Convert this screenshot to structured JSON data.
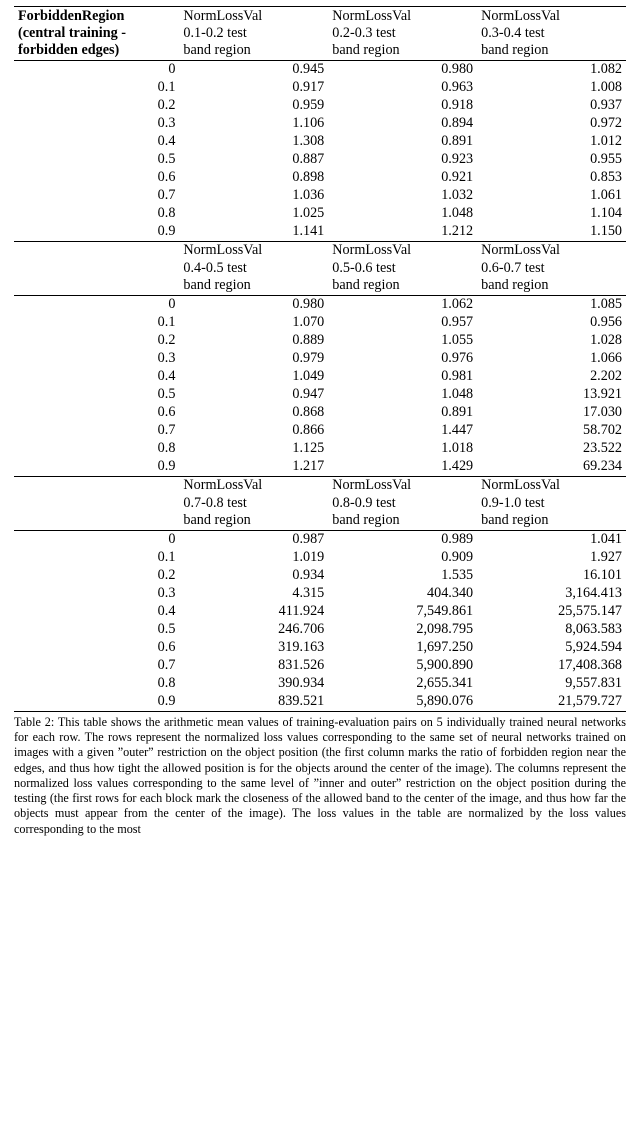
{
  "table": {
    "header0": {
      "col0_l1": "ForbiddenRegion",
      "col0_l2": "(central training -",
      "col0_l3": "forbidden edges)"
    },
    "blocks": [
      {
        "hdr": {
          "c1_l1": "NormLossVal",
          "c1_l2": "0.1-0.2 test",
          "c1_l3": "band region",
          "c2_l1": "NormLossVal",
          "c2_l2": "0.2-0.3 test",
          "c2_l3": "band region",
          "c3_l1": "NormLossVal",
          "c3_l2": "0.3-0.4 test",
          "c3_l3": "band region"
        },
        "rows": [
          {
            "k": "0",
            "v": [
              "0.945",
              "0.980",
              "1.082"
            ]
          },
          {
            "k": "0.1",
            "v": [
              "0.917",
              "0.963",
              "1.008"
            ]
          },
          {
            "k": "0.2",
            "v": [
              "0.959",
              "0.918",
              "0.937"
            ]
          },
          {
            "k": "0.3",
            "v": [
              "1.106",
              "0.894",
              "0.972"
            ]
          },
          {
            "k": "0.4",
            "v": [
              "1.308",
              "0.891",
              "1.012"
            ]
          },
          {
            "k": "0.5",
            "v": [
              "0.887",
              "0.923",
              "0.955"
            ]
          },
          {
            "k": "0.6",
            "v": [
              "0.898",
              "0.921",
              "0.853"
            ]
          },
          {
            "k": "0.7",
            "v": [
              "1.036",
              "1.032",
              "1.061"
            ]
          },
          {
            "k": "0.8",
            "v": [
              "1.025",
              "1.048",
              "1.104"
            ]
          },
          {
            "k": "0.9",
            "v": [
              "1.141",
              "1.212",
              "1.150"
            ]
          }
        ]
      },
      {
        "hdr": {
          "c1_l1": "NormLossVal",
          "c1_l2": "0.4-0.5 test",
          "c1_l3": "band region",
          "c2_l1": "NormLossVal",
          "c2_l2": "0.5-0.6 test",
          "c2_l3": "band region",
          "c3_l1": "NormLossVal",
          "c3_l2": "0.6-0.7 test",
          "c3_l3": "band region"
        },
        "rows": [
          {
            "k": "0",
            "v": [
              "0.980",
              "1.062",
              "1.085"
            ]
          },
          {
            "k": "0.1",
            "v": [
              "1.070",
              "0.957",
              "0.956"
            ]
          },
          {
            "k": "0.2",
            "v": [
              "0.889",
              "1.055",
              "1.028"
            ]
          },
          {
            "k": "0.3",
            "v": [
              "0.979",
              "0.976",
              "1.066"
            ]
          },
          {
            "k": "0.4",
            "v": [
              "1.049",
              "0.981",
              "2.202"
            ]
          },
          {
            "k": "0.5",
            "v": [
              "0.947",
              "1.048",
              "13.921"
            ]
          },
          {
            "k": "0.6",
            "v": [
              "0.868",
              "0.891",
              "17.030"
            ]
          },
          {
            "k": "0.7",
            "v": [
              "0.866",
              "1.447",
              "58.702"
            ]
          },
          {
            "k": "0.8",
            "v": [
              "1.125",
              "1.018",
              "23.522"
            ]
          },
          {
            "k": "0.9",
            "v": [
              "1.217",
              "1.429",
              "69.234"
            ]
          }
        ]
      },
      {
        "hdr": {
          "c1_l1": "NormLossVal",
          "c1_l2": "0.7-0.8 test",
          "c1_l3": "band region",
          "c2_l1": "NormLossVal",
          "c2_l2": "0.8-0.9 test",
          "c2_l3": "band region",
          "c3_l1": "NormLossVal",
          "c3_l2": "0.9-1.0 test",
          "c3_l3": "band region"
        },
        "rows": [
          {
            "k": "0",
            "v": [
              "0.987",
              "0.989",
              "1.041"
            ]
          },
          {
            "k": "0.1",
            "v": [
              "1.019",
              "0.909",
              "1.927"
            ]
          },
          {
            "k": "0.2",
            "v": [
              "0.934",
              "1.535",
              "16.101"
            ]
          },
          {
            "k": "0.3",
            "v": [
              "4.315",
              "404.340",
              "3,164.413"
            ]
          },
          {
            "k": "0.4",
            "v": [
              "411.924",
              "7,549.861",
              "25,575.147"
            ]
          },
          {
            "k": "0.5",
            "v": [
              "246.706",
              "2,098.795",
              "8,063.583"
            ]
          },
          {
            "k": "0.6",
            "v": [
              "319.163",
              "1,697.250",
              "5,924.594"
            ]
          },
          {
            "k": "0.7",
            "v": [
              "831.526",
              "5,900.890",
              "17,408.368"
            ]
          },
          {
            "k": "0.8",
            "v": [
              "390.934",
              "2,655.341",
              "9,557.831"
            ]
          },
          {
            "k": "0.9",
            "v": [
              "839.521",
              "5,890.076",
              "21,579.727"
            ]
          }
        ]
      }
    ]
  },
  "caption": {
    "label": "Table 2:",
    "text": " This table shows the arithmetic mean values of training-evaluation pairs on 5 individually trained neural networks for each row. The rows represent the normalized loss values corresponding to the same set of neural networks trained on images with a given ”outer” restriction on the object position (the first column marks the ratio of forbidden region near the edges, and thus how tight the allowed position is for the objects around the center of the image). The columns represent the normalized loss values corresponding to the same level of ”inner and outer” restriction on the object position during the testing (the first rows for each block mark the closeness of the allowed band to the center of the image, and thus how far the objects must appear from the center of the image). The loss values in the table are normalized by the loss values corresponding to the most"
  },
  "chart_data": {
    "type": "table",
    "title": "Table 2",
    "row_labels_name": "ForbiddenRegion (central training - forbidden edges)",
    "row_labels": [
      0,
      0.1,
      0.2,
      0.3,
      0.4,
      0.5,
      0.6,
      0.7,
      0.8,
      0.9
    ],
    "columns": [
      "NormLossVal 0.1-0.2 test band region",
      "NormLossVal 0.2-0.3 test band region",
      "NormLossVal 0.3-0.4 test band region",
      "NormLossVal 0.4-0.5 test band region",
      "NormLossVal 0.5-0.6 test band region",
      "NormLossVal 0.6-0.7 test band region",
      "NormLossVal 0.7-0.8 test band region",
      "NormLossVal 0.8-0.9 test band region",
      "NormLossVal 0.9-1.0 test band region"
    ],
    "data": [
      [
        0.945,
        0.98,
        1.082,
        0.98,
        1.062,
        1.085,
        0.987,
        0.989,
        1.041
      ],
      [
        0.917,
        0.963,
        1.008,
        1.07,
        0.957,
        0.956,
        1.019,
        0.909,
        1.927
      ],
      [
        0.959,
        0.918,
        0.937,
        0.889,
        1.055,
        1.028,
        0.934,
        1.535,
        16.101
      ],
      [
        1.106,
        0.894,
        0.972,
        0.979,
        0.976,
        1.066,
        4.315,
        404.34,
        3164.413
      ],
      [
        1.308,
        0.891,
        1.012,
        1.049,
        0.981,
        2.202,
        411.924,
        7549.861,
        25575.147
      ],
      [
        0.887,
        0.923,
        0.955,
        0.947,
        1.048,
        13.921,
        246.706,
        2098.795,
        8063.583
      ],
      [
        0.898,
        0.921,
        0.853,
        0.868,
        0.891,
        17.03,
        319.163,
        1697.25,
        5924.594
      ],
      [
        1.036,
        1.032,
        1.061,
        0.866,
        1.447,
        58.702,
        831.526,
        5900.89,
        17408.368
      ],
      [
        1.025,
        1.048,
        1.104,
        1.125,
        1.018,
        23.522,
        390.934,
        2655.341,
        9557.831
      ],
      [
        1.141,
        1.212,
        1.15,
        1.217,
        1.429,
        69.234,
        839.521,
        5890.076,
        21579.727
      ]
    ]
  }
}
